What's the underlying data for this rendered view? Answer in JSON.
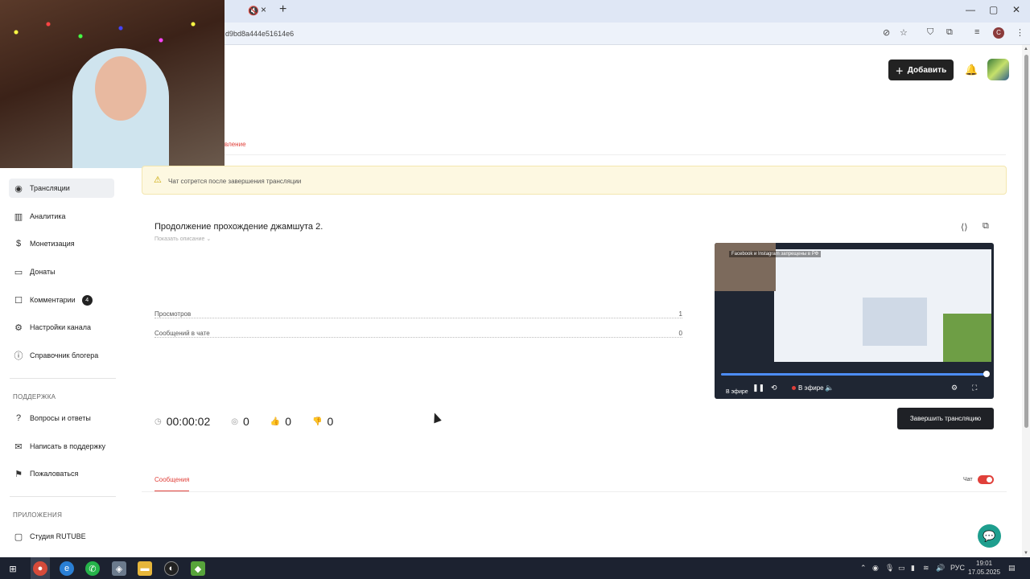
{
  "browser": {
    "url": "d9bd8a444e51614e6",
    "tab_close": "×",
    "tab_new": "+",
    "profile_initial": "C",
    "minimize": "—",
    "maximize": "▢",
    "close": "✕"
  },
  "header": {
    "add_button_label": "Добавить",
    "tab_partial_label": "вление"
  },
  "sidebar": {
    "items": [
      {
        "label": "Трансляции",
        "icon": "broadcast-icon"
      },
      {
        "label": "Аналитика",
        "icon": "chart-icon"
      },
      {
        "label": "Монетизация",
        "icon": "coin-icon"
      },
      {
        "label": "Донаты",
        "icon": "donate-icon"
      },
      {
        "label": "Комментарии",
        "icon": "comment-icon",
        "badge": "4"
      },
      {
        "label": "Настройки канала",
        "icon": "gear-icon"
      },
      {
        "label": "Справочник блогера",
        "icon": "info-icon"
      }
    ],
    "support_heading": "ПОДДЕРЖКА",
    "support_items": [
      {
        "label": "Вопросы и ответы",
        "icon": "question-icon"
      },
      {
        "label": "Написать в поддержку",
        "icon": "mail-icon"
      },
      {
        "label": "Пожаловаться",
        "icon": "flag-icon"
      }
    ],
    "apps_heading": "ПРИЛОЖЕНИЯ",
    "apps_items": [
      {
        "label": "Студия RUTUBE",
        "icon": "studio-icon"
      }
    ]
  },
  "warning": {
    "text": "Чат сотрется после завершения трансляции"
  },
  "stream": {
    "title": "Продолжение прохождение джамшута 2.",
    "show_description": "Показать описание",
    "stats": [
      {
        "label": "Просмотров",
        "value": "1"
      },
      {
        "label": "Сообщений в чате",
        "value": "0"
      }
    ],
    "duration": "00:00:02",
    "viewers": "0",
    "likes": "0",
    "dislikes": "0",
    "end_button_label": "Завершить трансляцию"
  },
  "player": {
    "caption": "Facebook и Instagram запрещены в РФ",
    "live_label": "В эфире",
    "live_label_small": "В эфире",
    "progress": 1.0
  },
  "chat": {
    "tab_label": "Сообщения",
    "toggle_label": "Чат",
    "toggle_on": true
  },
  "taskbar": {
    "time": "19:01",
    "date": "17.05.2025",
    "lang": "РУС"
  }
}
